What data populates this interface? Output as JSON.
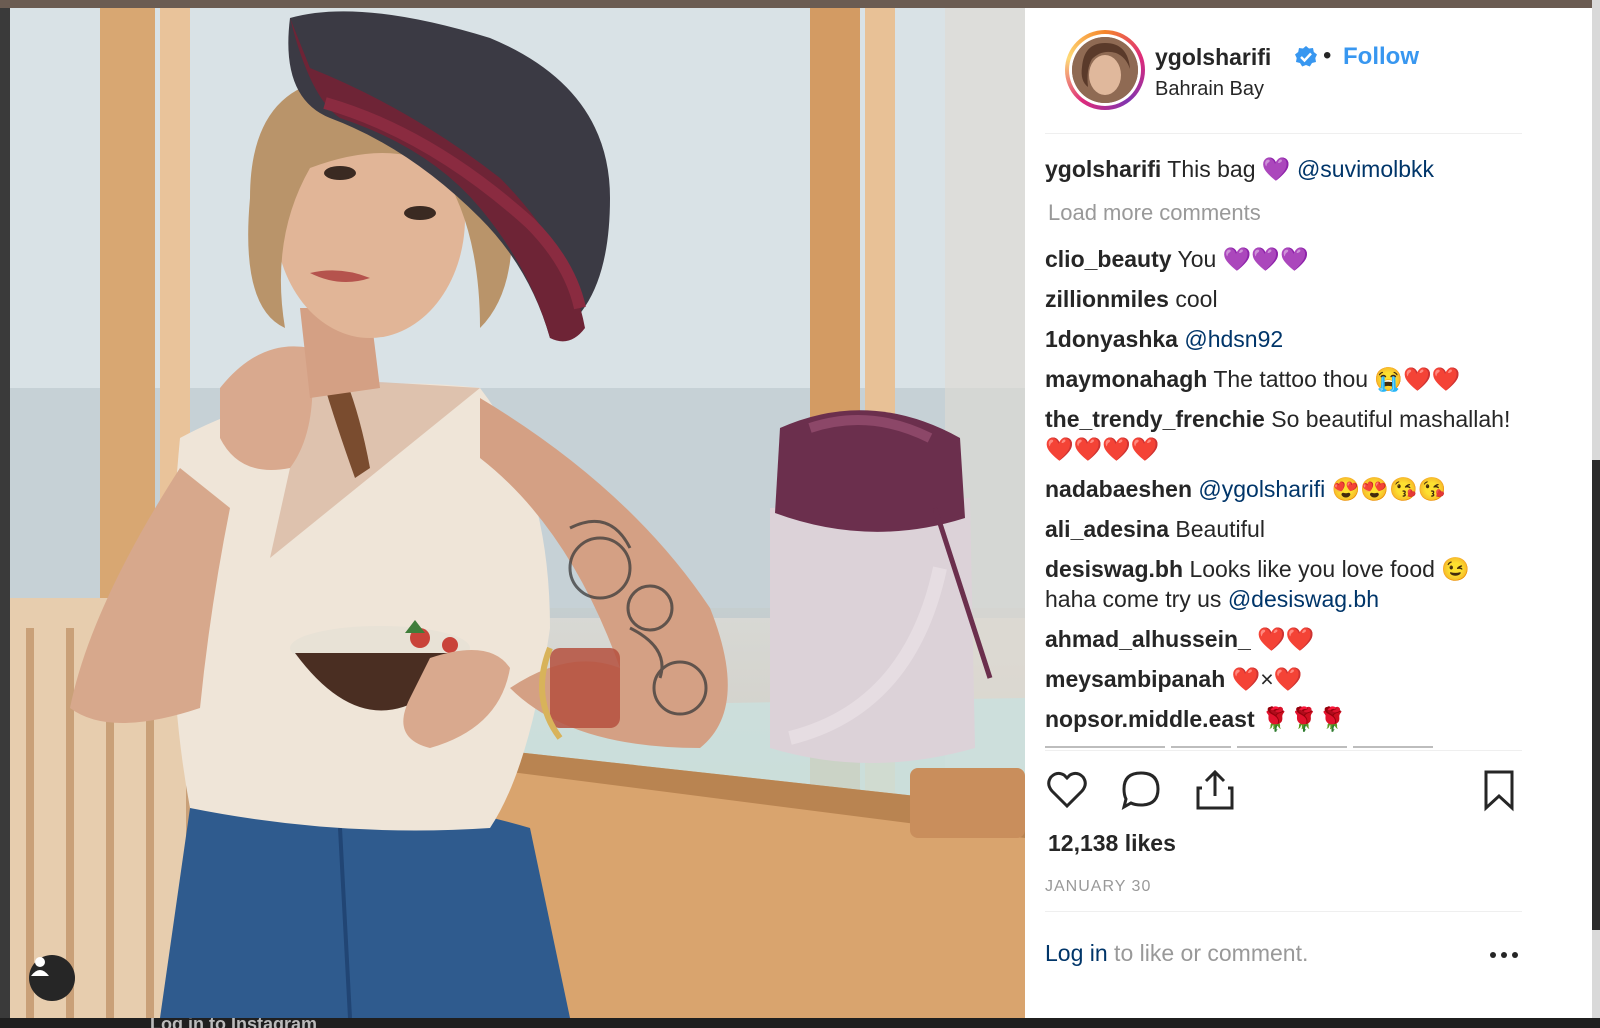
{
  "post": {
    "username": "ygolsharifi",
    "follow_label": "Follow",
    "separator": "•",
    "location": "Bahrain Bay",
    "caption": {
      "username": "ygolsharifi",
      "text": "This bag 💜",
      "mention": "@suvimolbkk"
    },
    "load_more": "Load more comments",
    "comments": [
      {
        "username": "clio_beauty",
        "text": "You 💜💜💜"
      },
      {
        "username": "zillionmiles",
        "text": "cool"
      },
      {
        "username": "1donyashka",
        "text": "",
        "mention": "@hdsn92"
      },
      {
        "username": "maymonahagh",
        "text": "The tattoo thou 😭❤️❤️"
      },
      {
        "username": "the_trendy_frenchie",
        "text": "So beautiful mashallah!",
        "text2": "❤️❤️❤️❤️"
      },
      {
        "username": "nadabaeshen",
        "text": "",
        "mention": "@ygolsharifi",
        "after": " 😍😍😘😘"
      },
      {
        "username": "ali_adesina",
        "text": "Beautiful"
      },
      {
        "username": "desiswag.bh",
        "text": "Looks like you love food 😉",
        "text2": "haha come try us ",
        "mention2": "@desiswag.bh"
      },
      {
        "username": "ahmad_alhussein_",
        "text": "❤️❤️"
      },
      {
        "username": "meysambipanah",
        "text": "❤️×❤️"
      },
      {
        "username": "nopsor.middle.east",
        "text": "🌹🌹🌹"
      }
    ],
    "likes": "12,138 likes",
    "date": "JANUARY 30",
    "footer": {
      "login": "Log in",
      "rest": " to like or comment."
    }
  },
  "backdrop": {
    "bottom_text": "Log in to Instagram"
  },
  "icons": {
    "verified": "verified-badge-icon",
    "like": "heart-icon",
    "comment": "comment-icon",
    "share": "share-icon",
    "save": "bookmark-icon",
    "more": "more-options-icon",
    "tag": "user-tag-icon"
  },
  "colors": {
    "link": "#3897f0",
    "mention": "#003569",
    "muted": "#999999",
    "text": "#262626"
  }
}
